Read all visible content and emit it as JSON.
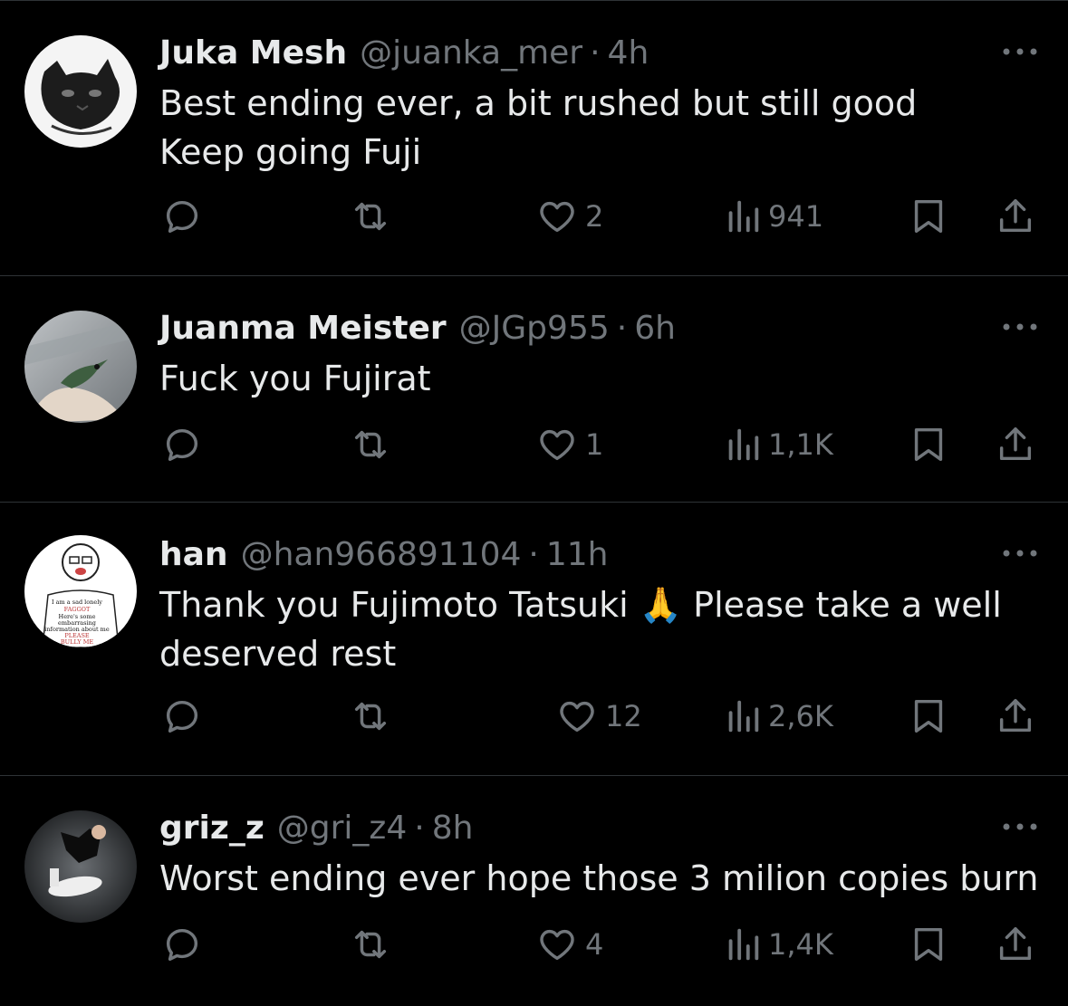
{
  "colors": {
    "background": "#000000",
    "text_primary": "#e7e9ea",
    "text_secondary": "#71767b",
    "divider": "#2f3336"
  },
  "icons": {
    "reply": "reply-icon",
    "retweet": "retweet-icon",
    "like": "heart-icon",
    "views": "views-bar-chart-icon",
    "bookmark": "bookmark-icon",
    "share": "share-upload-icon",
    "more": "more-dots-icon"
  },
  "tweets": [
    {
      "name": "Juka Mesh",
      "handle": "@juanka_mer",
      "separator": "·",
      "time": "4h",
      "text": "Best ending ever, a bit rushed but still good\nKeep going Fuji",
      "likes": "2",
      "views": "941"
    },
    {
      "name": "Juanma Meister",
      "handle": "@JGp955",
      "separator": "·",
      "time": "6h",
      "text": "Fuck you Fujirat",
      "likes": "1",
      "views": "1,1K"
    },
    {
      "name": "han",
      "handle": "@han966891104",
      "separator": "·",
      "time": "11h",
      "text": "Thank you Fujimoto Tatsuki 🙏 Please take a well\ndeserved rest",
      "likes": "12",
      "views": "2,6K",
      "avatar_text": [
        "I am a sad lonely",
        "FAGGOT",
        "Here's some",
        "embarrasing",
        "information about me",
        "PLEASE",
        "BULLY ME"
      ]
    },
    {
      "name": "griz_z",
      "handle": "@gri_z4",
      "separator": "·",
      "time": "8h",
      "text": "Worst ending ever hope those 3 milion copies burn",
      "likes": "4",
      "views": "1,4K"
    }
  ]
}
